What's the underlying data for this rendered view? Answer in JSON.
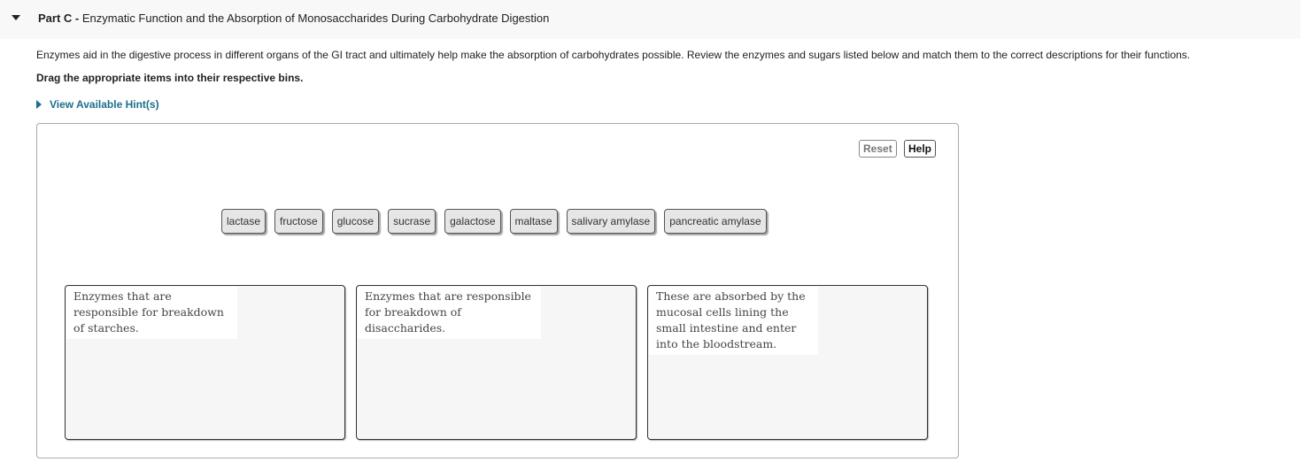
{
  "part": {
    "label": "Part C -",
    "title": "Enzymatic Function and the Absorption of Monosaccharides During Carbohydrate Digestion"
  },
  "intro_text": "Enzymes aid in the digestive process in different organs of the GI tract and ultimately help make the absorption of carbohydrates possible. Review the enzymes and sugars listed below and match them to the correct descriptions for their functions.",
  "instruction": "Drag the appropriate items into their respective bins.",
  "hint_link": "View Available Hint(s)",
  "buttons": {
    "reset": "Reset",
    "help": "Help"
  },
  "tiles": [
    "lactase",
    "fructose",
    "glucose",
    "sucrase",
    "galactose",
    "maltase",
    "salivary amylase",
    "pancreatic amylase"
  ],
  "bins": [
    {
      "label": "Enzymes that are responsible for breakdown of starches."
    },
    {
      "label": "Enzymes that are responsible for breakdown of disaccharides."
    },
    {
      "label": "These are absorbed by the mucosal cells lining the small intestine and enter into the bloodstream."
    }
  ],
  "colors": {
    "header_bg": "#f8f8f8",
    "link": "#1a6f8c",
    "tile_bg": "#e6e6e6",
    "bin_bg": "#f6f6f6"
  }
}
